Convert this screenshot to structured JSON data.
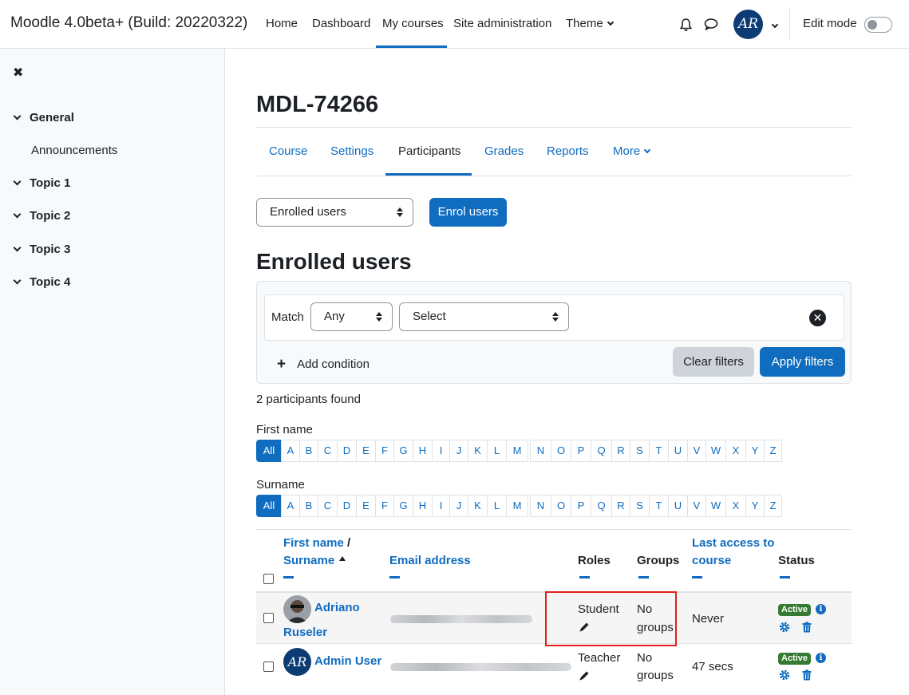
{
  "navbar": {
    "brand": "Moodle 4.0beta+ (Build: 20220322)",
    "items": [
      "Home",
      "Dashboard",
      "My courses",
      "Site administration",
      "Theme"
    ],
    "active": "My courses",
    "avatar_initials": "AR",
    "edit_mode_label": "Edit mode",
    "edit_mode_on": false
  },
  "sidebar": {
    "close_glyph": "✖",
    "sections": [
      "General",
      "Topic 1",
      "Topic 2",
      "Topic 3",
      "Topic 4"
    ],
    "general_items": [
      "Announcements"
    ]
  },
  "course": {
    "title": "MDL-74266",
    "tabs": [
      "Course",
      "Settings",
      "Participants",
      "Grades",
      "Reports",
      "More"
    ],
    "active_tab": "Participants"
  },
  "toolbar": {
    "enrolled_select": "Enrolled users",
    "enrol_button": "Enrol users"
  },
  "heading": "Enrolled users",
  "filter": {
    "match_label": "Match",
    "match_value": "Any",
    "select_value": "Select",
    "add_condition": "Add condition",
    "clear_filters": "Clear filters",
    "apply_filters": "Apply filters"
  },
  "participants_found": "2 participants found",
  "initials_bar": {
    "first_name_label": "First name",
    "surname_label": "Surname",
    "all": "All",
    "letters": [
      "A",
      "B",
      "C",
      "D",
      "E",
      "F",
      "G",
      "H",
      "I",
      "J",
      "K",
      "L",
      "M",
      "N",
      "O",
      "P",
      "Q",
      "R",
      "S",
      "T",
      "U",
      "V",
      "W",
      "X",
      "Y",
      "Z"
    ]
  },
  "table": {
    "headers": {
      "first_name": "First name",
      "slash": "/",
      "surname": "Surname",
      "email": "Email address",
      "roles": "Roles",
      "groups": "Groups",
      "last_access_1": "Last access to",
      "last_access_2": "course",
      "status": "Status"
    },
    "rows": [
      {
        "name_1": "Adriano",
        "name_2": "Ruseler",
        "role": "Student",
        "groups_1": "No",
        "groups_2": "groups",
        "last_access": "Never",
        "status": "Active"
      },
      {
        "name_1": "Admin User",
        "role": "Teacher",
        "groups_1": "No",
        "groups_2": "groups",
        "last_access": "47 secs",
        "status": "Active",
        "avatar_initials": "AR"
      }
    ]
  },
  "colors": {
    "primary": "#0f6cbf",
    "active_badge": "#357a32",
    "highlight": "#e0201d"
  }
}
